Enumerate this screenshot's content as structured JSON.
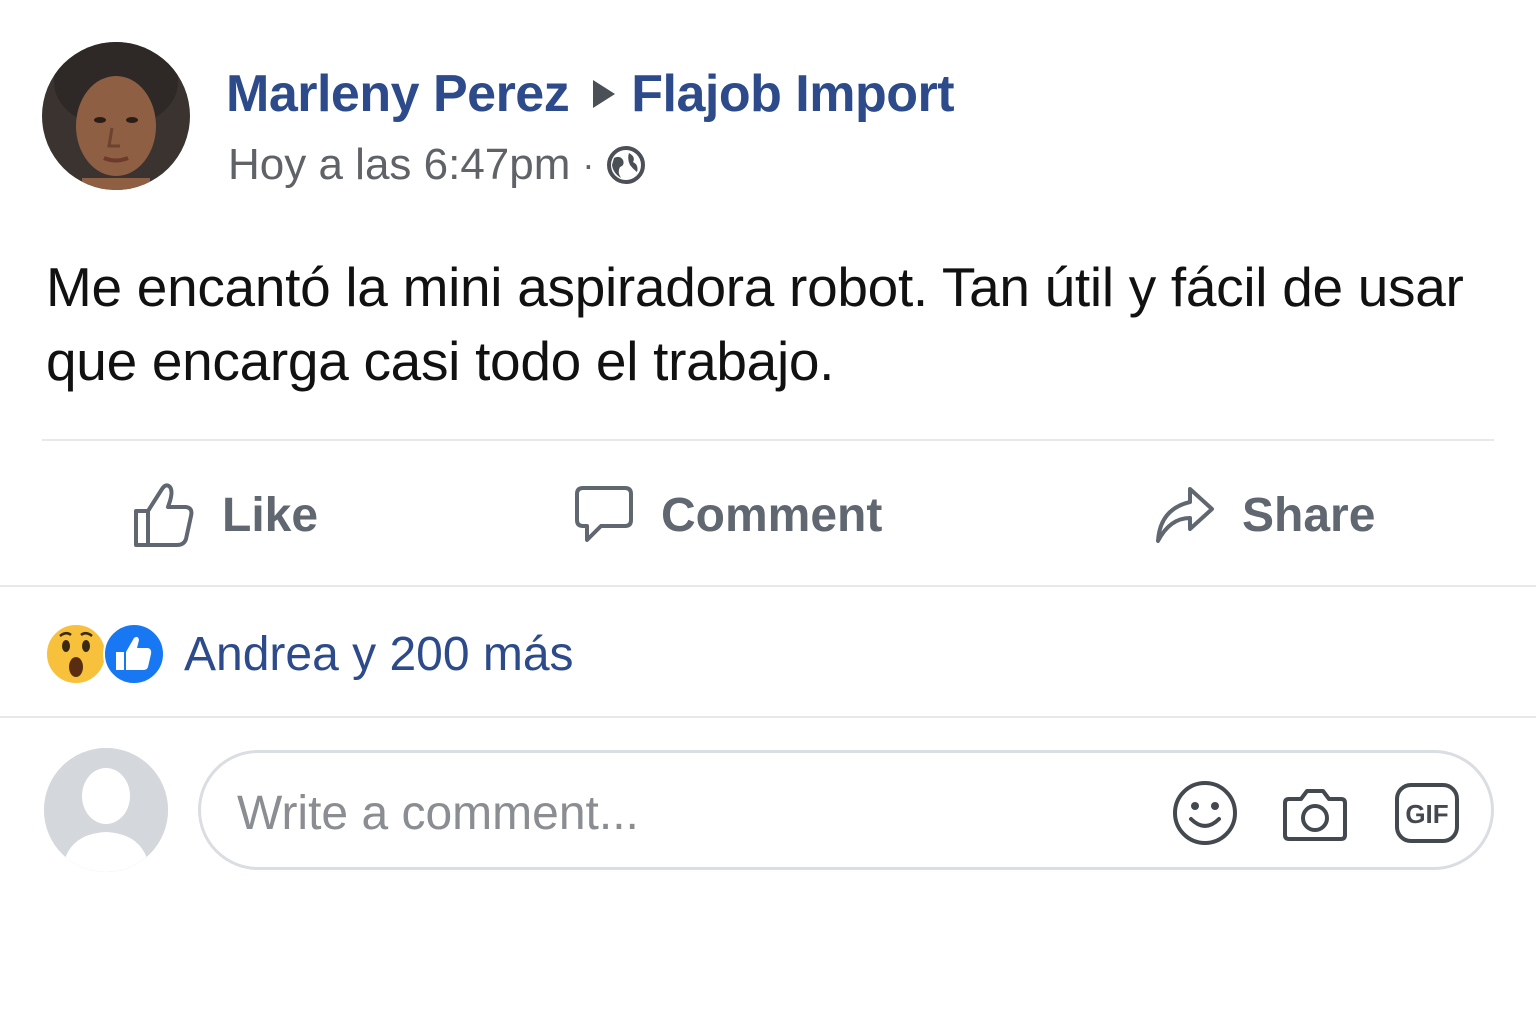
{
  "post": {
    "author": "Marleny Perez",
    "page": "Flajob Import",
    "timestamp": "Hoy a las 6:47pm",
    "separator": "·",
    "privacy_icon": "globe-icon",
    "text": "Me encantó la mini aspiradora robot. Tan útil y fácil de usar que encarga casi todo el trabajo."
  },
  "actions": {
    "like_label": "Like",
    "comment_label": "Comment",
    "share_label": "Share"
  },
  "reactions": {
    "icons": [
      "wow-icon",
      "like-icon"
    ],
    "summary": "Andrea y 200 más"
  },
  "composer": {
    "placeholder": "Write a comment...",
    "tools": [
      "emoji-icon",
      "camera-icon",
      "gif-icon"
    ],
    "gif_label": "GIF"
  },
  "colors": {
    "name_blue": "#2d4b8a",
    "action_gray": "#606770",
    "like_blue": "#1877f2",
    "wow_yellow": "#f7c13b"
  }
}
